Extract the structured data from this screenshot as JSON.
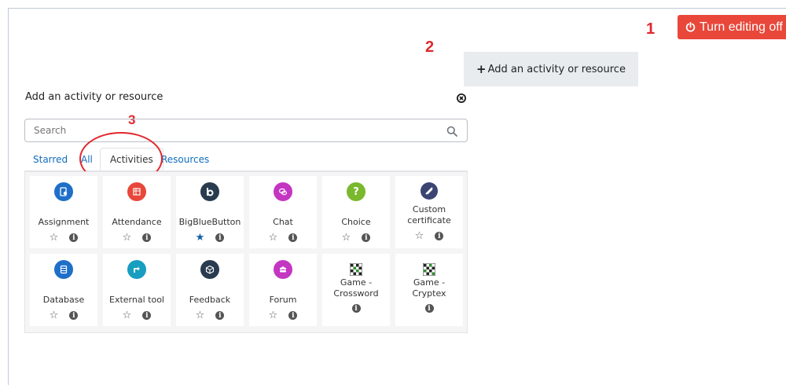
{
  "annotations": {
    "one": "1",
    "two": "2",
    "three": "3"
  },
  "turn_editing_button": {
    "label": "Turn editing off"
  },
  "add_activity_button": {
    "label": "Add an activity or resource"
  },
  "chooser": {
    "title": "Add an activity or resource",
    "search_placeholder": "Search",
    "tabs": [
      {
        "label": "Starred"
      },
      {
        "label": "All"
      },
      {
        "label": "Activities"
      },
      {
        "label": "Resources"
      }
    ],
    "items": [
      {
        "name": "Assignment",
        "icon": "assignment-icon",
        "color": "#1f6fc8",
        "starred": false,
        "star": "☆",
        "info": "i"
      },
      {
        "name": "Attendance",
        "icon": "attendance-icon",
        "color": "#e8473a",
        "starred": false,
        "star": "☆",
        "info": "i"
      },
      {
        "name": "BigBlueButton",
        "icon": "bigbluebutton-icon",
        "color": "#283b4f",
        "starred": true,
        "star": "★",
        "info": "i"
      },
      {
        "name": "Chat",
        "icon": "chat-icon",
        "color": "#c435c2",
        "starred": false,
        "star": "☆",
        "info": "i"
      },
      {
        "name": "Choice",
        "icon": "choice-icon",
        "color": "#7ab82e",
        "starred": false,
        "star": "☆",
        "info": "i"
      },
      {
        "name": "Custom certificate",
        "icon": "custom-certificate-icon",
        "color": "#3a4572",
        "starred": false,
        "star": "☆",
        "info": "i"
      },
      {
        "name": "Database",
        "icon": "database-icon",
        "color": "#1f6fc8",
        "starred": false,
        "star": "☆",
        "info": "i"
      },
      {
        "name": "External tool",
        "icon": "external-tool-icon",
        "color": "#179ec0",
        "starred": false,
        "star": "☆",
        "info": "i"
      },
      {
        "name": "Feedback",
        "icon": "feedback-icon",
        "color": "#283b4f",
        "starred": false,
        "star": "☆",
        "info": "i"
      },
      {
        "name": "Forum",
        "icon": "forum-icon",
        "color": "#c435c2",
        "starred": false,
        "star": "☆",
        "info": "i"
      },
      {
        "name": "Game - Crossword",
        "icon": "crossword-icon",
        "color": "#4a7c3a",
        "starred": null,
        "star": "",
        "info": "i"
      },
      {
        "name": "Game - Cryptex",
        "icon": "cryptex-icon",
        "color": "#4a7c3a",
        "starred": null,
        "star": "",
        "info": "i"
      }
    ]
  }
}
